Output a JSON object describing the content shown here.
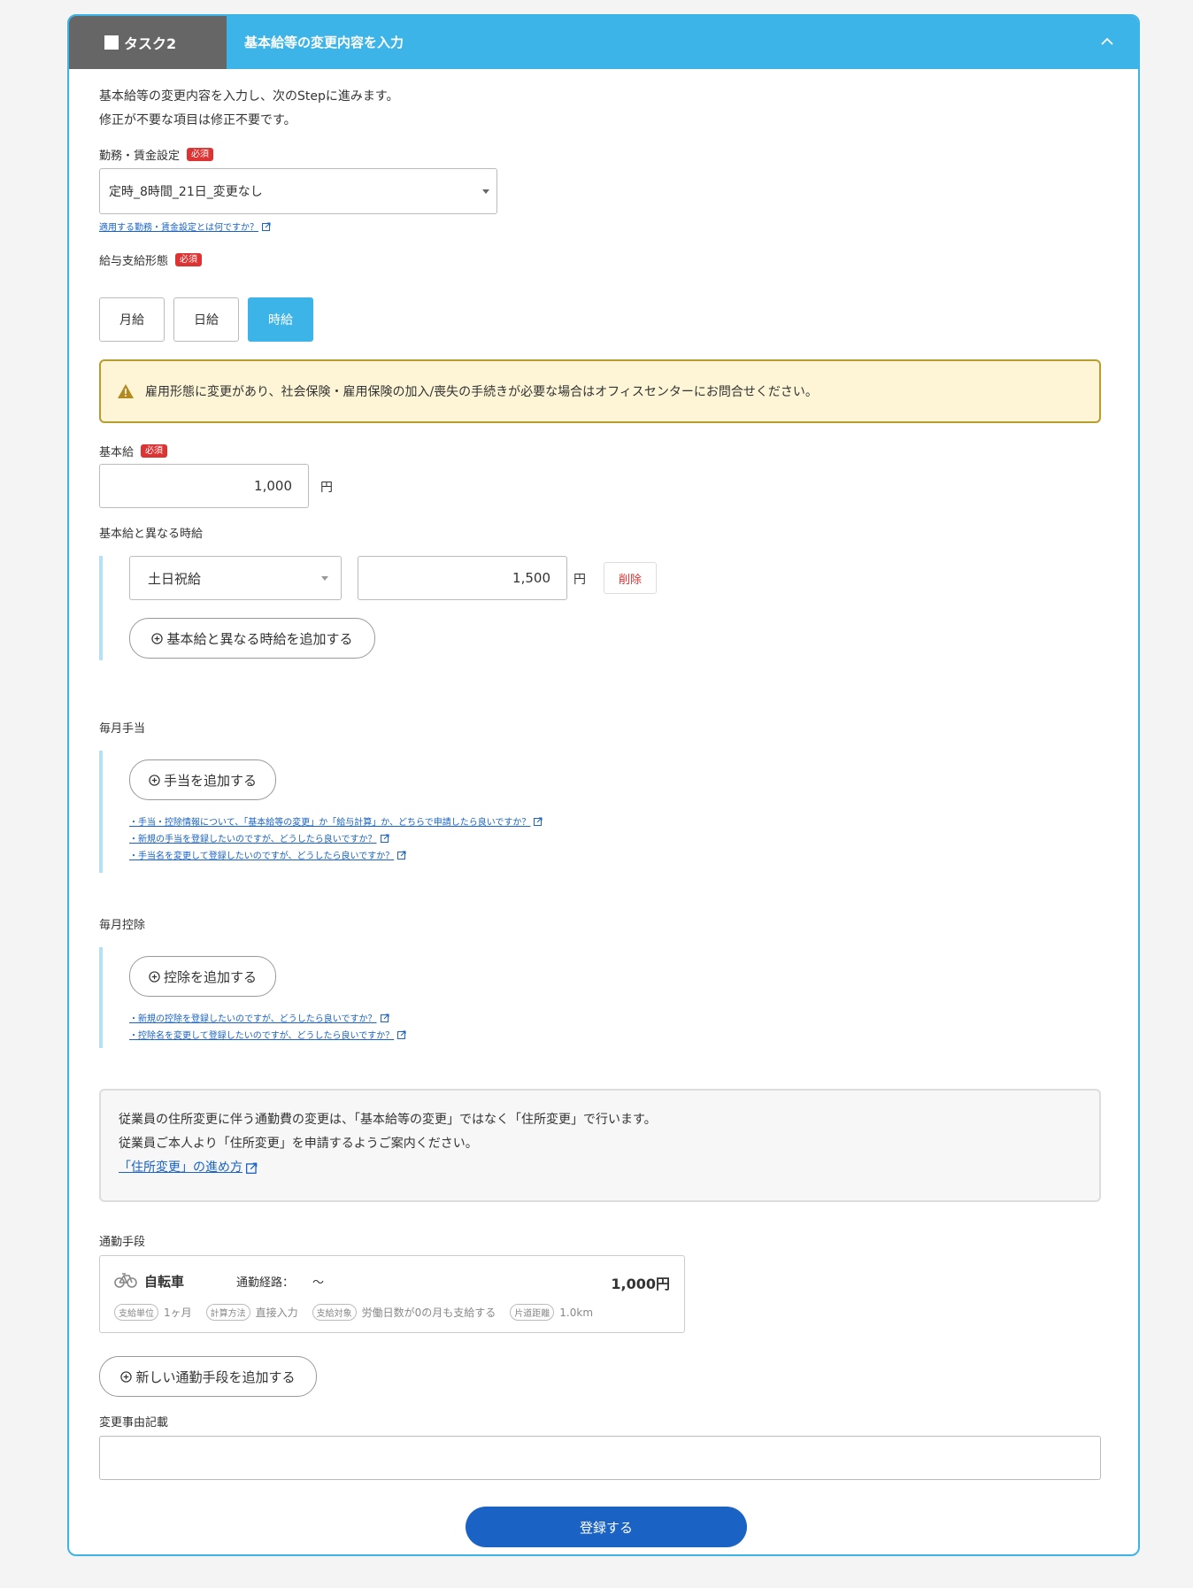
{
  "header": {
    "task_label": "タスク2",
    "title": "基本給等の変更内容を入力"
  },
  "intro": {
    "line1": "基本給等の変更内容を入力し、次のStepに進みます。",
    "line2": "修正が不要な項目は修正不要です。"
  },
  "required_badge": "必須",
  "work_setting": {
    "label": "勤務・賃金設定",
    "value": "定時_8時間_21日_変更なし",
    "help": "適用する勤務・賃金設定とは何ですか？"
  },
  "pay_type": {
    "label": "給与支給形態",
    "options": [
      "月給",
      "日給",
      "時給"
    ],
    "selected": "時給"
  },
  "warning": {
    "text": "雇用形態に変更があり、社会保険・雇用保険の加入/喪失の手続きが必要な場合はオフィスセンターにお問合せください。"
  },
  "base_pay": {
    "label": "基本給",
    "value": "1,000",
    "unit": "円"
  },
  "other_rates": {
    "label": "基本給と異なる時給",
    "items": [
      {
        "type": "土日祝給",
        "value": "1,500",
        "unit": "円",
        "delete_label": "削除"
      }
    ],
    "add_label": "基本給と異なる時給を追加する"
  },
  "allowance": {
    "label": "毎月手当",
    "add_label": "手当を追加する",
    "links": [
      "・手当・控除情報について、「基本給等の変更」か「給与計算」か、どちらで申請したら良いですか？",
      "・新規の手当を登録したいのですが、どうしたら良いですか？",
      "・手当名を変更して登録したいのですが、どうしたら良いですか？"
    ]
  },
  "deduction": {
    "label": "毎月控除",
    "add_label": "控除を追加する",
    "links": [
      "・新規の控除を登録したいのですが、どうしたら良いですか？",
      "・控除名を変更して登録したいのですが、どうしたら良いですか？"
    ]
  },
  "address_notice": {
    "line1": "従業員の住所変更に伴う通勤費の変更は、「基本給等の変更」ではなく「住所変更」で行います。",
    "line2": "従業員ご本人より「住所変更」を申請するようご案内ください。",
    "link": "「住所変更」の進め方"
  },
  "commute": {
    "label": "通勤手段",
    "card": {
      "mode": "自転車",
      "route_label": "通勤経路：",
      "route": "～",
      "amount": "1,000円",
      "tags": [
        {
          "tag": "支給単位",
          "value": "1ヶ月"
        },
        {
          "tag": "計算方法",
          "value": "直接入力"
        },
        {
          "tag": "支給対象",
          "value": "労働日数が0の月も支給する"
        },
        {
          "tag": "片道距離",
          "value": "1.0km"
        }
      ]
    },
    "add_label": "新しい通勤手段を追加する"
  },
  "reason": {
    "label": "変更事由記載",
    "value": ""
  },
  "submit_label": "登録する",
  "colors": {
    "accent": "#3db4e7",
    "primary": "#1a63c4",
    "required": "#dd3333",
    "warning_border": "#b79c2e",
    "warning_bg": "#fdf5d6"
  }
}
